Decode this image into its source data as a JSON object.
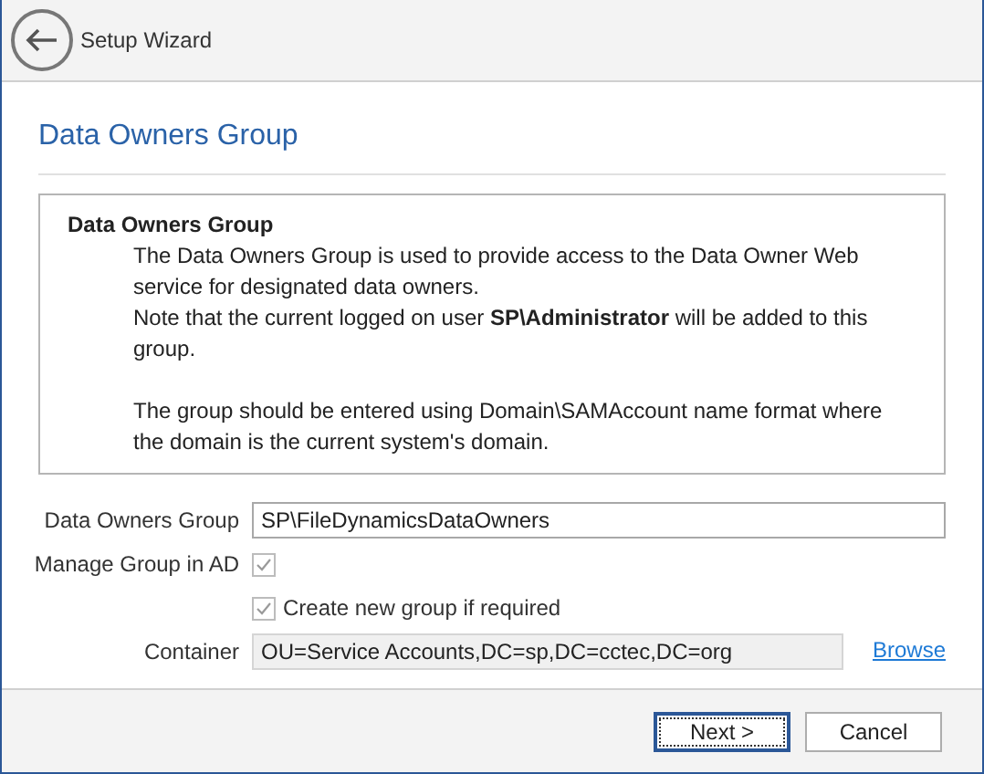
{
  "window": {
    "title": "Setup Wizard"
  },
  "page_title": "Data Owners Group",
  "info": {
    "heading": "Data Owners Group",
    "blocks": [
      [
        "The Data Owners Group is used to provide access to the Data Owner Web service for designated data owners.",
        "Note that the current logged on user **SP\\Administrator** will be added to this group."
      ],
      [
        "The group should be entered using Domain\\SAMAccount name format where the domain is the current system's domain."
      ]
    ]
  },
  "form": [
    {
      "kind": "text",
      "label": "Data Owners Group",
      "value": "SP\\FileDynamicsDataOwners",
      "readonly": false
    },
    {
      "kind": "checkbox",
      "label": "Manage Group in AD",
      "checked": true,
      "disabled": true
    },
    {
      "kind": "checkbox",
      "text": "Create new group if required",
      "checked": true,
      "disabled": true
    },
    {
      "kind": "text",
      "label": "Container",
      "value": "OU=Service Accounts,DC=sp,DC=cctec,DC=org",
      "readonly": true,
      "link": "Browse"
    }
  ],
  "buttons": [
    {
      "label": "Next >",
      "default": true
    },
    {
      "label": "Cancel",
      "default": false
    }
  ]
}
